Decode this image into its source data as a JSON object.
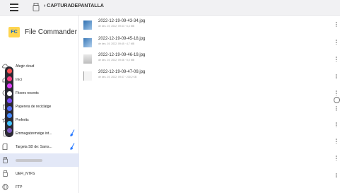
{
  "header": {
    "breadcrumb": "CAPTURADEPANTALLA"
  },
  "app": {
    "logo_text": "FC",
    "name": "File Commander"
  },
  "sidebar": {
    "items": [
      {
        "label": "Afegir cloud",
        "icon": "cloud-add-icon"
      },
      {
        "label": "Inici",
        "icon": "home-icon"
      },
      {
        "label": "Fitxers recents",
        "icon": "recent-icon"
      },
      {
        "label": "Paperera de reciclatge",
        "icon": "trash-icon"
      },
      {
        "label": "Preferits",
        "icon": "star-icon"
      },
      {
        "label": "Emmagatzematge int...",
        "icon": "internal-storage-icon"
      },
      {
        "label": "Targeta SD de: Sams...",
        "icon": "sd-card-icon"
      },
      {
        "label": "",
        "icon": "usb-icon"
      },
      {
        "label": "UEFI_NTFS",
        "icon": "usb-icon"
      },
      {
        "label": "FTP",
        "icon": "ftp-globe-icon"
      }
    ]
  },
  "files": [
    {
      "name": "2022-12-19-09-43-34.jpg",
      "meta": "de des. 19, 2022, 09:44 · 6,4 MB"
    },
    {
      "name": "2022-12-19-09-45-18.jpg",
      "meta": "de des. 19, 2022, 09:45 · 4,7 MB"
    },
    {
      "name": "2022-12-19-09-46-19.jpg",
      "meta": "de des. 19, 2022, 09:46 · 5,0 MB"
    },
    {
      "name": "2022-12-19-09-47-09.jpg",
      "meta": "de des. 19, 2022, 09:47 · 230,2 KB"
    }
  ],
  "colors": {
    "accent": "#1565c0",
    "selected_bg": "#e3e8f7",
    "dock": "#2b2a33"
  }
}
